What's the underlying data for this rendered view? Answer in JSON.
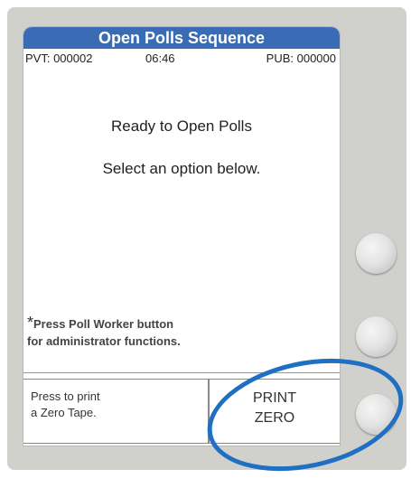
{
  "screen": {
    "title": "Open Polls Sequence",
    "status": {
      "pvt": "PVT: 000002",
      "time": "06:46",
      "pub": "PUB: 000000"
    },
    "message_primary": "Ready to Open Polls",
    "message_secondary": "Select an option below.",
    "note_star": "*",
    "note_line1": "Press Poll Worker button",
    "note_line2": "for administrator functions."
  },
  "footer": {
    "left_line1": "Press to print",
    "left_line2": "a Zero Tape.",
    "right_line1": "PRINT",
    "right_line2": "ZERO"
  },
  "colors": {
    "title_bar": "#3a6bb5",
    "highlight": "#1f6fc2"
  }
}
